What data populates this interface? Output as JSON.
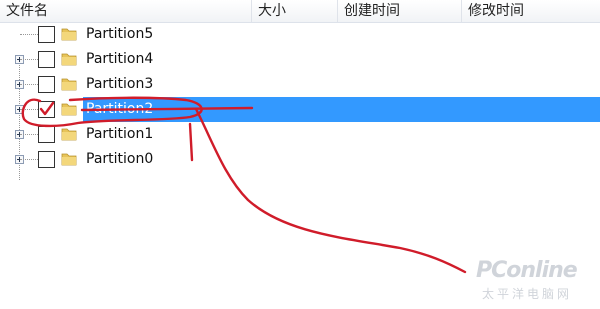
{
  "columns": {
    "name": "文件名",
    "size": "大小",
    "created": "创建时间",
    "modified": "修改时间"
  },
  "tree": {
    "items": [
      {
        "label": "Partition5",
        "checked": false,
        "expandable": false,
        "selected": false
      },
      {
        "label": "Partition4",
        "checked": false,
        "expandable": true,
        "selected": false
      },
      {
        "label": "Partition3",
        "checked": false,
        "expandable": true,
        "selected": false
      },
      {
        "label": "Partition2",
        "checked": true,
        "expandable": true,
        "selected": true
      },
      {
        "label": "Partition1",
        "checked": false,
        "expandable": true,
        "selected": false
      },
      {
        "label": "Partition0",
        "checked": false,
        "expandable": true,
        "selected": false
      }
    ]
  },
  "colors": {
    "selection": "#3399ff",
    "annotation": "#d01c2a",
    "folder": "#e7c45a"
  },
  "icons": {
    "folder": "folder-icon",
    "expander": "plus-expander-icon",
    "checkmark": "checkmark-icon"
  },
  "watermark": {
    "main": "PConline",
    "sub": "太平洋电脑网"
  }
}
